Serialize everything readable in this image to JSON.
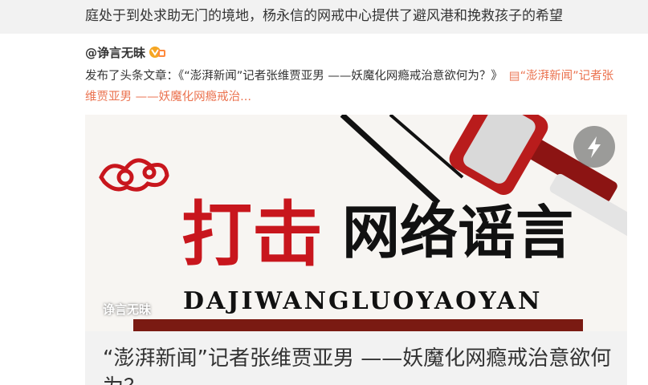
{
  "repost": {
    "tail_text": "庭处于到处求助无门的境地，杨永信的网戒中心提供了避风港和挽救孩子的希望"
  },
  "post": {
    "author": "@诤言无昧",
    "badge_icon": "vip-icon",
    "text_prefix": "发布了头条文章：《“澎湃新闻”记者张维贾亚男 ——妖魔化网瘾戒治意欲何为？》",
    "link_icon": "article-icon",
    "link_text": "“澎湃新闻”记者张维贾亚男 ——妖魔化网瘾戒治..."
  },
  "card": {
    "cover_headline_red": "打击",
    "cover_headline_black": "网络谣言",
    "cover_pinyin": "DAJIWANGLUOYAOYAN",
    "watermark": "诤言无昧",
    "flash_icon": "lightning-icon",
    "title": "“澎湃新闻”记者张维贾亚男 ——妖魔化网瘾戒治意欲何为？"
  },
  "colors": {
    "link": "#eb7350",
    "headline_red": "#c8161d",
    "band": "#f2f2f2"
  }
}
